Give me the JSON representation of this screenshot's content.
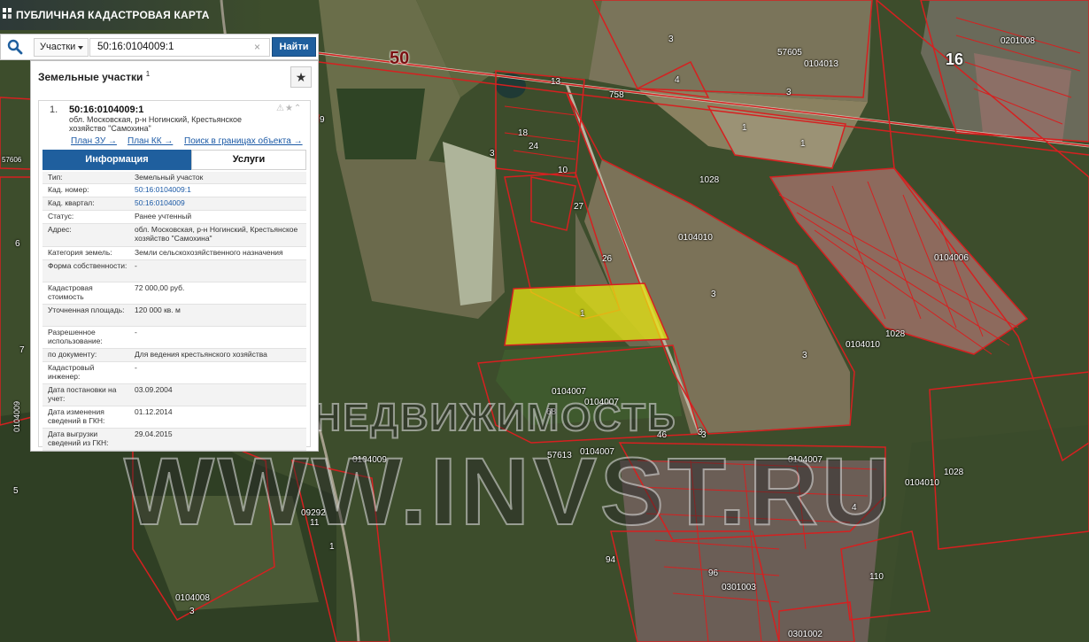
{
  "app": {
    "title": "ПУБЛИЧНАЯ КАДАСТРОВАЯ КАРТА"
  },
  "search": {
    "type_label": "Участки",
    "query": "50:16:0104009:1",
    "clear_glyph": "×",
    "button_label": "Найти"
  },
  "panel": {
    "title": "Земельные участки",
    "count": "1",
    "favorite_glyph": "★",
    "item": {
      "number": "1.",
      "cadastral_id": "50:16:0104009:1",
      "address": "обл. Московская, р-н Ногинский, Крестьянское хозяйство \"Самохина\"",
      "status_icons": "⚠★⌃",
      "links": {
        "plan_zu": "План ЗУ →",
        "plan_kk": "План КК →",
        "search_in_bounds": "Поиск в границах объекта →"
      },
      "tabs": {
        "info": "Информация",
        "services": "Услуги"
      },
      "properties": [
        {
          "key": "Тип:",
          "value": "Земельный участок"
        },
        {
          "key": "Кад. номер:",
          "value": "50:16:0104009:1"
        },
        {
          "key": "Кад. квартал:",
          "value": "50:16:0104009"
        },
        {
          "key": "Статус:",
          "value": "Ранее учтенный"
        },
        {
          "key": "Адрес:",
          "value": "обл. Московская, р-н Ногинский, Крестьянское хозяйство \"Самохина\""
        },
        {
          "key": "Категория земель:",
          "value": "Земли сельскохозяйственного назначения"
        },
        {
          "key": "Форма собственности:",
          "value": "-"
        },
        {
          "key": "Кадастровая стоимость",
          "value": "72 000,00 руб."
        },
        {
          "key": "Уточненная площадь:",
          "value": "120 000 кв. м"
        },
        {
          "key": "Разрешенное использование:",
          "value": "-"
        },
        {
          "key": "по документу:",
          "value": "Для ведения крестьянского хозяйства"
        },
        {
          "key": "Кадастровый инженер:",
          "value": "-"
        },
        {
          "key": "Дата постановки на учет:",
          "value": "03.09.2004"
        },
        {
          "key": "Дата изменения сведений в ГКН:",
          "value": "01.12.2014"
        },
        {
          "key": "Дата выгрузки сведений из ГКН:",
          "value": "29.04.2015"
        }
      ]
    }
  },
  "map": {
    "region_label": "50",
    "watermark_top": "ИНВЕСТ НЕДВИЖИМОСТЬ",
    "watermark_bottom": "WWW.INVST.RU",
    "labels": [
      "3",
      "0104013",
      "4",
      "3",
      "57605",
      "16",
      "0201008",
      "13",
      "758",
      "1",
      "1",
      "18",
      "24",
      "3",
      "10",
      "27",
      "1028",
      "0104006",
      "26",
      "0104010",
      "3",
      "1",
      "3",
      "0104010",
      "1028",
      "0104007",
      "3",
      "0104007",
      "0104009",
      "57613",
      "0104007",
      "0104007",
      "46",
      "3",
      "0104010",
      "1028",
      "4",
      "68",
      "09292",
      "11",
      "1",
      "0104008",
      "3",
      "94",
      "96",
      "0301003",
      "110",
      "0301002",
      "6",
      "7",
      "9",
      "57606",
      "0104009",
      "5"
    ],
    "colors": {
      "parcel_outline": "#d62020",
      "selected_fill": "#e6e612",
      "map_base": "#3b4a2a"
    }
  }
}
